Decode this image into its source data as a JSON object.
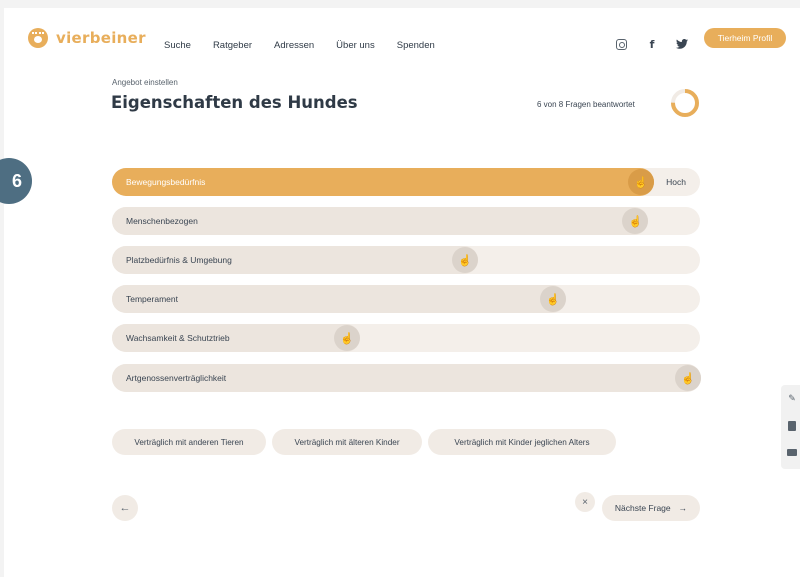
{
  "brand": {
    "name": "vierbeiner",
    "color": "#e8ae5b"
  },
  "nav": {
    "items": [
      "Suche",
      "Ratgeber",
      "Adressen",
      "Über uns",
      "Spenden"
    ]
  },
  "social": {
    "icons": [
      "instagram-icon",
      "facebook-icon",
      "twitter-icon"
    ]
  },
  "header": {
    "profile_button": "Tierheim Profil"
  },
  "form": {
    "breadcrumb": "Angebot einstellen",
    "title": "Eigenschaften des Hundes",
    "progress_text": "6 von 8 Fragen beantwortet",
    "progress_fraction": 0.75,
    "step_number": "6"
  },
  "sliders": [
    {
      "label": "Bewegungsbedürfnis",
      "level": 0.9,
      "active": true,
      "value_label": "Hoch"
    },
    {
      "label": "Menschenbezogen",
      "level": 0.89,
      "active": false,
      "value_label": ""
    },
    {
      "label": "Platzbedürfnis & Umgebung",
      "level": 0.6,
      "active": false,
      "value_label": ""
    },
    {
      "label": "Temperament",
      "level": 0.75,
      "active": false,
      "value_label": ""
    },
    {
      "label": "Wachsamkeit & Schutztrieb",
      "level": 0.4,
      "active": false,
      "value_label": ""
    },
    {
      "label": "Artgenossenverträglichkeit",
      "level": 0.98,
      "active": false,
      "value_label": ""
    }
  ],
  "chips": [
    "Verträglich mit anderen Tieren",
    "Verträglich mit älteren Kinder",
    "Verträglich mit Kinder jeglichen Alters"
  ],
  "footer_nav": {
    "back_icon": "←",
    "close_icon": "×",
    "next_label": "Nächste Frage",
    "next_icon": "→"
  },
  "colors": {
    "accent": "#e8ae5b",
    "accent_dark": "#d99c48",
    "track": "#f4efea",
    "badge": "#4e6e82"
  }
}
